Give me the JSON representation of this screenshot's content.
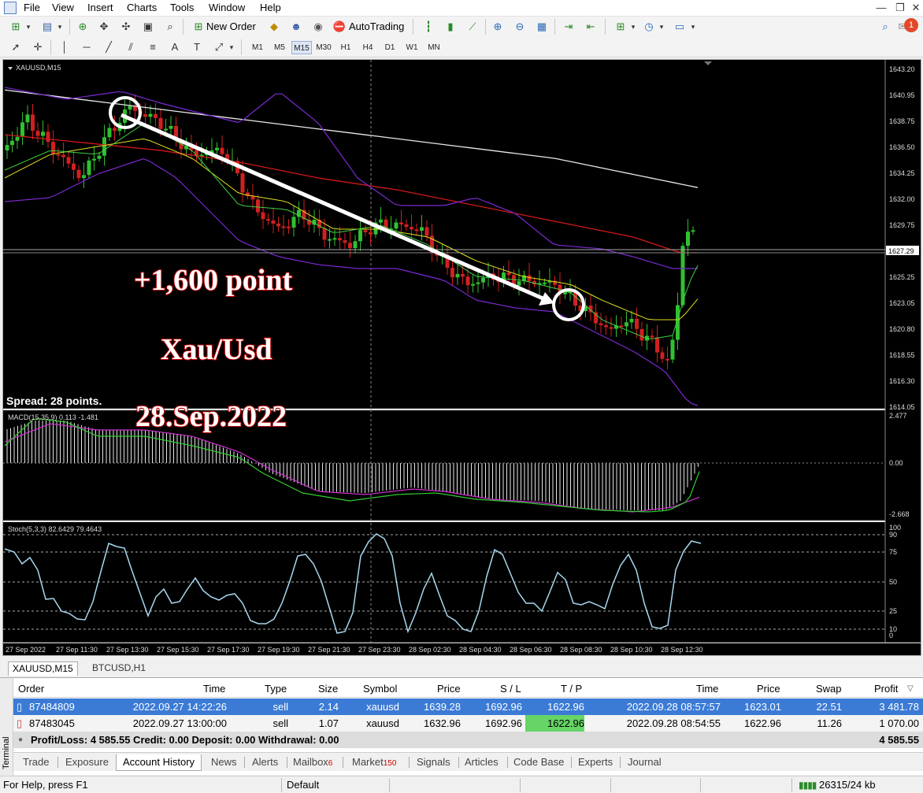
{
  "menu": [
    "File",
    "View",
    "Insert",
    "Charts",
    "Tools",
    "Window",
    "Help"
  ],
  "toolbar": {
    "new_order": "New Order",
    "autotrading": "AutoTrading"
  },
  "timeframes": [
    "M1",
    "M5",
    "M15",
    "M30",
    "H1",
    "H4",
    "D1",
    "W1",
    "MN"
  ],
  "active_timeframe": "M15",
  "chart": {
    "symbol_title": "XAUUSD,M15",
    "price_scale": [
      "1643.20",
      "1640.95",
      "1638.75",
      "1636.50",
      "1634.25",
      "1632.00",
      "1629.75",
      "1627.29",
      "1625.25",
      "1623.05",
      "1620.80",
      "1618.55",
      "1616.30",
      "1614.05"
    ],
    "current_price": "1627.29",
    "spread": "Spread: 28 points.",
    "annotations": {
      "profit": "+1,600 point",
      "pair": "Xau/Usd",
      "date": "28.Sep.2022"
    },
    "macd_label": "MACD(15,35,9) 0.113 -1.481",
    "macd_scale": [
      "2.477",
      "0.00",
      "-2.668"
    ],
    "stoch_label": "Stoch(5,3,3) 82.6429 79.4643",
    "stoch_scale": [
      "100",
      "90",
      "75",
      "50",
      "25",
      "10",
      "0"
    ],
    "time_labels": [
      "27 Sep 2022",
      "27 Sep 11:30",
      "27 Sep 13:30",
      "27 Sep 15:30",
      "27 Sep 17:30",
      "27 Sep 19:30",
      "27 Sep 21:30",
      "27 Sep 23:30",
      "28 Sep 02:30",
      "28 Sep 04:30",
      "28 Sep 06:30",
      "28 Sep 08:30",
      "28 Sep 10:30",
      "28 Sep 12:30"
    ]
  },
  "chart_tabs": [
    "XAUUSD,M15",
    "BTCUSD,H1"
  ],
  "terminal": {
    "side_label": "Terminal",
    "headers": {
      "order": "Order",
      "time": "Time",
      "type": "Type",
      "size": "Size",
      "symbol": "Symbol",
      "price": "Price",
      "sl": "S / L",
      "tp": "T / P",
      "time2": "Time",
      "price2": "Price",
      "swap": "Swap",
      "profit": "Profit"
    },
    "rows": [
      {
        "order": "87484809",
        "time": "2022.09.27 14:22:26",
        "type": "sell",
        "size": "2.14",
        "symbol": "xauusd",
        "price": "1639.28",
        "sl": "1692.96",
        "tp": "1622.96",
        "time2": "2022.09.28 08:57:57",
        "price2": "1623.01",
        "swap": "22.51",
        "profit": "3 481.78"
      },
      {
        "order": "87483045",
        "time": "2022.09.27 13:00:00",
        "type": "sell",
        "size": "1.07",
        "symbol": "xauusd",
        "price": "1632.96",
        "sl": "1692.96",
        "tp": "1622.96",
        "time2": "2022.09.28 08:54:55",
        "price2": "1622.96",
        "swap": "11.26",
        "profit": "1 070.00"
      }
    ],
    "summary": "Profit/Loss: 4 585.55  Credit: 0.00  Deposit: 0.00  Withdrawal: 0.00",
    "summary_total": "4 585.55",
    "tabs": [
      "Trade",
      "Exposure",
      "Account History",
      "News",
      "Alerts",
      "Mailbox",
      "Market",
      "Signals",
      "Articles",
      "Code Base",
      "Experts",
      "Journal"
    ],
    "badges": {
      "mailbox": "6",
      "market": "150"
    },
    "active_tab": "Account History"
  },
  "status": {
    "help": "For Help, press F1",
    "profile": "Default",
    "traffic": "26315/24 kb"
  },
  "notification_count": "1"
}
